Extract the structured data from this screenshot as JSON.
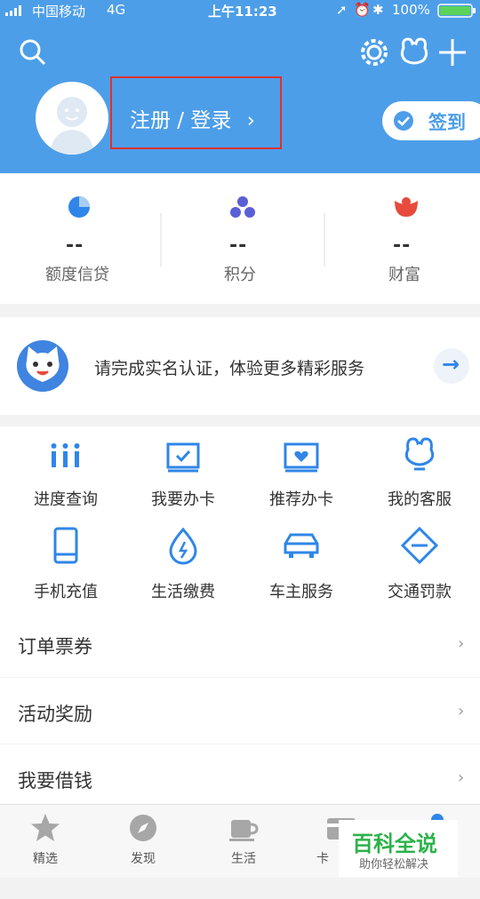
{
  "status_bar": {
    "carrier": "中国移动",
    "network": "4G",
    "time": "上午11:23",
    "battery": "100%"
  },
  "header": {
    "login_label": "注册 / 登录",
    "login_chevron": "›",
    "checkin_label": "签到"
  },
  "stats": [
    {
      "value": "--",
      "label": "额度信贷"
    },
    {
      "value": "--",
      "label": "积分"
    },
    {
      "value": "--",
      "label": "财富"
    }
  ],
  "banner": {
    "text": "请完成实名认证，体验更多精彩服务",
    "arrow": "→"
  },
  "grid": [
    {
      "label": "进度查询",
      "icon": "progress-icon"
    },
    {
      "label": "我要办卡",
      "icon": "card-apply-icon"
    },
    {
      "label": "推荐办卡",
      "icon": "card-recommend-icon"
    },
    {
      "label": "我的客服",
      "icon": "service-icon"
    },
    {
      "label": "手机充值",
      "icon": "phone-icon"
    },
    {
      "label": "生活缴费",
      "icon": "utility-icon"
    },
    {
      "label": "车主服务",
      "icon": "car-icon"
    },
    {
      "label": "交通罚款",
      "icon": "traffic-icon"
    }
  ],
  "list": [
    {
      "label": "订单票券",
      "chevron": "›"
    },
    {
      "label": "活动奖励",
      "chevron": "›"
    },
    {
      "label": "我要借钱",
      "chevron": "›"
    }
  ],
  "tabs": [
    {
      "label": "精选",
      "icon": "star-icon"
    },
    {
      "label": "发现",
      "icon": "compass-icon"
    },
    {
      "label": "生活",
      "icon": "cup-icon"
    },
    {
      "label": "卡",
      "icon": "card-icon"
    }
  ],
  "watermark": {
    "title": "百科全说",
    "subtitle": "助你轻松解决"
  },
  "colors": {
    "brand_blue": "#4d9ee8",
    "icon_blue": "#2f86e8",
    "highlight_red": "#e0302a",
    "watermark_green": "#2db24a"
  }
}
